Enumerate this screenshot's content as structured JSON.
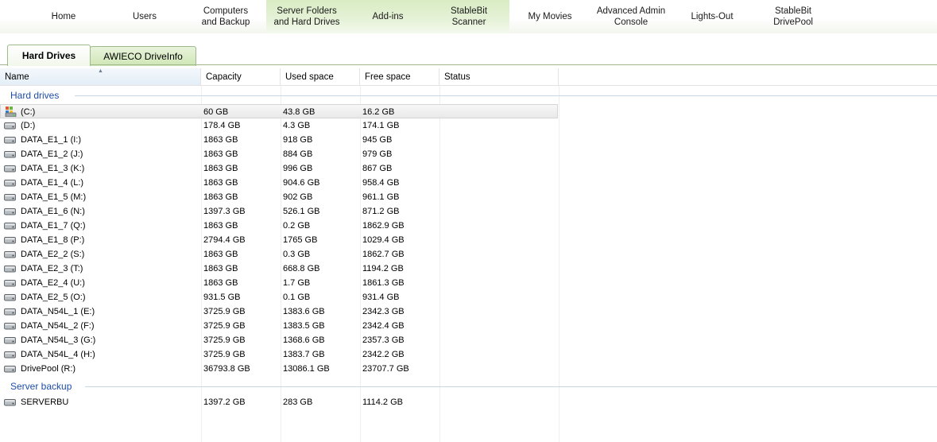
{
  "nav": [
    {
      "label": "Home",
      "green": false
    },
    {
      "label": "Users",
      "green": false
    },
    {
      "label": "Computers\nand Backup",
      "green": false
    },
    {
      "label": "Server Folders\nand Hard Drives",
      "green": true
    },
    {
      "label": "Add-ins",
      "green": true
    },
    {
      "label": "StableBit\nScanner",
      "green": true
    },
    {
      "label": "My Movies",
      "green": false
    },
    {
      "label": "Advanced Admin\nConsole",
      "green": false
    },
    {
      "label": "Lights-Out",
      "green": false
    },
    {
      "label": "StableBit\nDrivePool",
      "green": false
    }
  ],
  "tabs": [
    {
      "label": "Hard Drives",
      "active": true
    },
    {
      "label": "AWIECO DriveInfo",
      "active": false
    }
  ],
  "columns": {
    "name": "Name",
    "capacity": "Capacity",
    "used": "Used space",
    "free": "Free space",
    "status": "Status"
  },
  "groups": [
    {
      "title": "Hard drives",
      "rows": [
        {
          "icon": "system-drive-icon",
          "name": "(C:)",
          "capacity": "60 GB",
          "used": "43.8 GB",
          "free": "16.2 GB",
          "status": "",
          "selected": true
        },
        {
          "icon": "hard-drive-icon",
          "name": "(D:)",
          "capacity": "178.4 GB",
          "used": "4.3 GB",
          "free": "174.1 GB",
          "status": ""
        },
        {
          "icon": "hard-drive-icon",
          "name": "DATA_E1_1 (I:)",
          "capacity": "1863 GB",
          "used": "918 GB",
          "free": "945 GB",
          "status": ""
        },
        {
          "icon": "hard-drive-icon",
          "name": "DATA_E1_2 (J:)",
          "capacity": "1863 GB",
          "used": "884 GB",
          "free": "979 GB",
          "status": ""
        },
        {
          "icon": "hard-drive-icon",
          "name": "DATA_E1_3 (K:)",
          "capacity": "1863 GB",
          "used": "996 GB",
          "free": "867 GB",
          "status": ""
        },
        {
          "icon": "hard-drive-icon",
          "name": "DATA_E1_4 (L:)",
          "capacity": "1863 GB",
          "used": "904.6 GB",
          "free": "958.4 GB",
          "status": ""
        },
        {
          "icon": "hard-drive-icon",
          "name": "DATA_E1_5 (M:)",
          "capacity": "1863 GB",
          "used": "902 GB",
          "free": "961.1 GB",
          "status": ""
        },
        {
          "icon": "hard-drive-icon",
          "name": "DATA_E1_6 (N:)",
          "capacity": "1397.3 GB",
          "used": "526.1 GB",
          "free": "871.2 GB",
          "status": ""
        },
        {
          "icon": "hard-drive-icon",
          "name": "DATA_E1_7 (Q:)",
          "capacity": "1863 GB",
          "used": "0.2 GB",
          "free": "1862.9 GB",
          "status": ""
        },
        {
          "icon": "hard-drive-icon",
          "name": "DATA_E1_8 (P:)",
          "capacity": "2794.4 GB",
          "used": "1765 GB",
          "free": "1029.4 GB",
          "status": ""
        },
        {
          "icon": "hard-drive-icon",
          "name": "DATA_E2_2 (S:)",
          "capacity": "1863 GB",
          "used": "0.3 GB",
          "free": "1862.7 GB",
          "status": ""
        },
        {
          "icon": "hard-drive-icon",
          "name": "DATA_E2_3 (T:)",
          "capacity": "1863 GB",
          "used": "668.8 GB",
          "free": "1194.2 GB",
          "status": ""
        },
        {
          "icon": "hard-drive-icon",
          "name": "DATA_E2_4 (U:)",
          "capacity": "1863 GB",
          "used": "1.7 GB",
          "free": "1861.3 GB",
          "status": ""
        },
        {
          "icon": "hard-drive-icon",
          "name": "DATA_E2_5 (O:)",
          "capacity": "931.5 GB",
          "used": "0.1 GB",
          "free": "931.4 GB",
          "status": ""
        },
        {
          "icon": "hard-drive-icon",
          "name": "DATA_N54L_1 (E:)",
          "capacity": "3725.9 GB",
          "used": "1383.6 GB",
          "free": "2342.3 GB",
          "status": ""
        },
        {
          "icon": "hard-drive-icon",
          "name": "DATA_N54L_2 (F:)",
          "capacity": "3725.9 GB",
          "used": "1383.5 GB",
          "free": "2342.4 GB",
          "status": ""
        },
        {
          "icon": "hard-drive-icon",
          "name": "DATA_N54L_3 (G:)",
          "capacity": "3725.9 GB",
          "used": "1368.6 GB",
          "free": "2357.3 GB",
          "status": ""
        },
        {
          "icon": "hard-drive-icon",
          "name": "DATA_N54L_4 (H:)",
          "capacity": "3725.9 GB",
          "used": "1383.7 GB",
          "free": "2342.2 GB",
          "status": ""
        },
        {
          "icon": "hard-drive-icon",
          "name": "DrivePool (R:)",
          "capacity": "36793.8 GB",
          "used": "13086.1 GB",
          "free": "23707.7 GB",
          "status": ""
        }
      ]
    },
    {
      "title": "Server backup",
      "rows": [
        {
          "icon": "hard-drive-icon",
          "name": "SERVERBU",
          "capacity": "1397.2 GB",
          "used": "283 GB",
          "free": "1114.2 GB",
          "status": ""
        }
      ]
    }
  ],
  "colors": {
    "group_title": "#1f4ea8",
    "tab_border": "#9eb98a",
    "nav_highlight": "#d9ecc3"
  }
}
